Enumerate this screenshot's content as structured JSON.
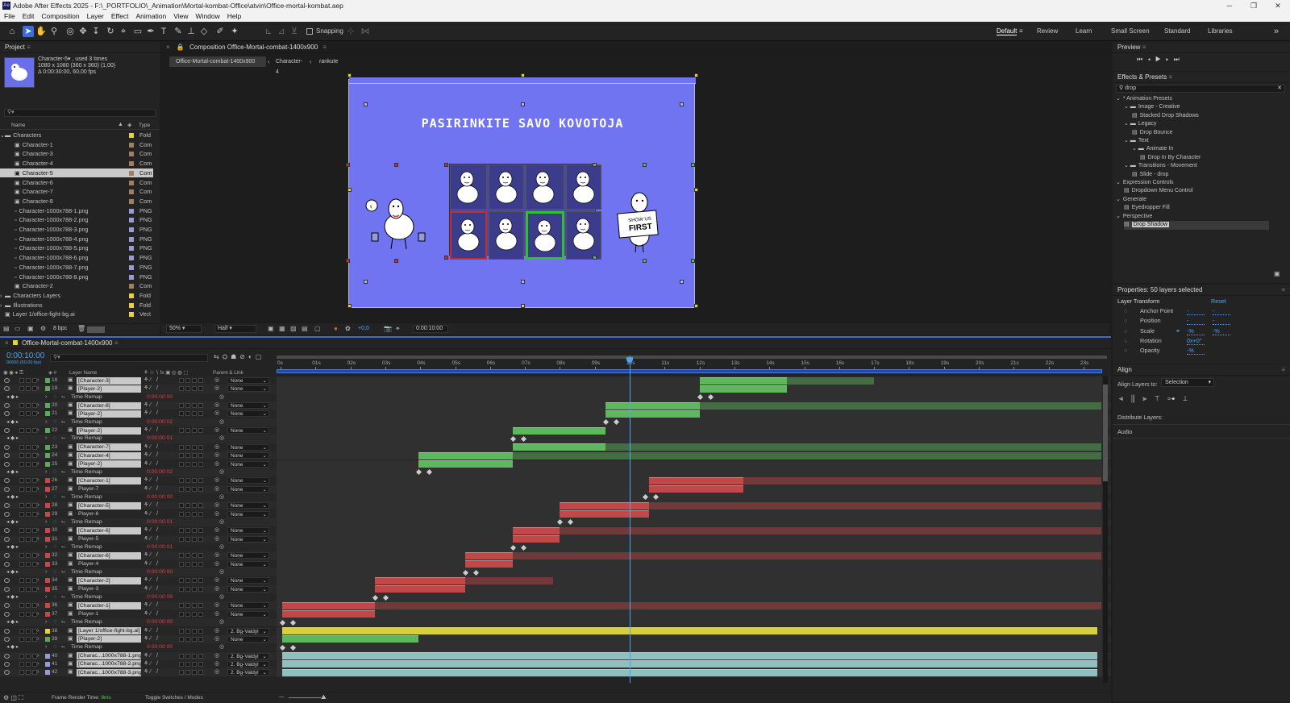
{
  "titlebar": {
    "text": "Adobe After Effects 2025 - F:\\_PORTFOLIO\\_Animation\\Mortal-kombat-Office\\atvin\\Office-mortal-kombat.aep",
    "logo": "Ae"
  },
  "menu": [
    "File",
    "Edit",
    "Composition",
    "Layer",
    "Effect",
    "Animation",
    "View",
    "Window",
    "Help"
  ],
  "toolbar": {
    "snapping": "Snapping",
    "workspaces": [
      "Default",
      "Review",
      "Learn",
      "Small Screen",
      "Standard",
      "Libraries"
    ]
  },
  "project": {
    "title": "Project",
    "selected_name": "Character-5▾ , used 3 times",
    "selected_dims": "1080 x 1080  (360 x 360) (1,00)",
    "selected_dur": "Δ 0:00:30:00, 60,00 fps",
    "col_name": "Name",
    "col_type": "Type",
    "bpc": "8 bpc",
    "items": [
      {
        "name": "Characters",
        "type": "Fold",
        "color": "#e8d23a",
        "indent": 0,
        "folder": true,
        "open": true
      },
      {
        "name": "Character-1",
        "type": "Com",
        "color": "#a08060",
        "indent": 1
      },
      {
        "name": "Character-3",
        "type": "Com",
        "color": "#a08060",
        "indent": 1
      },
      {
        "name": "Character-4",
        "type": "Com",
        "color": "#a08060",
        "indent": 1
      },
      {
        "name": "Character-5",
        "type": "Com",
        "color": "#a08060",
        "indent": 1,
        "selected": true
      },
      {
        "name": "Character-6",
        "type": "Com",
        "color": "#a08060",
        "indent": 1
      },
      {
        "name": "Character-7",
        "type": "Com",
        "color": "#a08060",
        "indent": 1
      },
      {
        "name": "Character-8",
        "type": "Com",
        "color": "#a08060",
        "indent": 1
      },
      {
        "name": "Character-1000x788-1.png",
        "type": "PNG",
        "color": "#9a9ad8",
        "indent": 1
      },
      {
        "name": "Character-1000x788-2.png",
        "type": "PNG",
        "color": "#9a9ad8",
        "indent": 1
      },
      {
        "name": "Character-1000x788-3.png",
        "type": "PNG",
        "color": "#9a9ad8",
        "indent": 1
      },
      {
        "name": "Character-1000x788-4.png",
        "type": "PNG",
        "color": "#9a9ad8",
        "indent": 1
      },
      {
        "name": "Character-1000x788-5.png",
        "type": "PNG",
        "color": "#9a9ad8",
        "indent": 1
      },
      {
        "name": "Character-1000x788-6.png",
        "type": "PNG",
        "color": "#9a9ad8",
        "indent": 1
      },
      {
        "name": "Character-1000x788-7.png",
        "type": "PNG",
        "color": "#9a9ad8",
        "indent": 1
      },
      {
        "name": "Character-1000x788-8.png",
        "type": "PNG",
        "color": "#9a9ad8",
        "indent": 1
      },
      {
        "name": "Character-2",
        "type": "Com",
        "color": "#a08060",
        "indent": 1
      },
      {
        "name": "Characters Layers",
        "type": "Fold",
        "color": "#e8d23a",
        "indent": 0,
        "folder": true
      },
      {
        "name": "Illustrations",
        "type": "Fold",
        "color": "#e8d23a",
        "indent": 0,
        "folder": true
      },
      {
        "name": "Layer 1/office-fight-bg.ai",
        "type": "Vect",
        "color": "#e8d23a",
        "indent": 0
      }
    ]
  },
  "composition": {
    "title": "Composition Office-Mortal-combat-1400x900",
    "crumbs": [
      "Office-Mortal-combat-1400x900",
      "Character-4",
      "rankute"
    ],
    "canvas_title": "PASIRINKITE SAVO KOVOTOJA",
    "sign_text": [
      "SHOW US",
      "FIRST"
    ],
    "zoom": "50%",
    "quality": "Half",
    "exposure": "+0,0",
    "timecode": "0:00:10:00"
  },
  "preview": {
    "title": "Preview"
  },
  "effects": {
    "title": "Effects & Presets",
    "search": "drop",
    "items": [
      {
        "label": "* Animation Presets",
        "level": 0,
        "kind": "arrow"
      },
      {
        "label": "Image - Creative",
        "level": 1,
        "kind": "folder"
      },
      {
        "label": "Stacked Drop Shadows",
        "level": 2,
        "kind": "preset"
      },
      {
        "label": "Legacy",
        "level": 1,
        "kind": "folder"
      },
      {
        "label": "Drop Bounce",
        "level": 2,
        "kind": "preset"
      },
      {
        "label": "Text",
        "level": 1,
        "kind": "folder"
      },
      {
        "label": "Animate In",
        "level": 2,
        "kind": "folder"
      },
      {
        "label": "Drop In By Character",
        "level": 3,
        "kind": "preset"
      },
      {
        "label": "Transitions - Movement",
        "level": 1,
        "kind": "folder"
      },
      {
        "label": "Slide - drop",
        "level": 2,
        "kind": "preset"
      },
      {
        "label": "Expression Controls",
        "level": 0,
        "kind": "arrow"
      },
      {
        "label": "Dropdown Menu Control",
        "level": 1,
        "kind": "preset"
      },
      {
        "label": "Generate",
        "level": 0,
        "kind": "arrow"
      },
      {
        "label": "Eyedropper Fill",
        "level": 1,
        "kind": "preset"
      },
      {
        "label": "Perspective",
        "level": 0,
        "kind": "arrow"
      },
      {
        "label": "Drop Shadow",
        "level": 1,
        "kind": "preset",
        "selected": true
      }
    ]
  },
  "properties": {
    "title": "Properties: 50 layers selected",
    "section": "Layer Transform",
    "reset": "Reset",
    "rows": [
      {
        "label": "Anchor Point",
        "v1": "-",
        "v2": "-"
      },
      {
        "label": "Position",
        "v1": "-",
        "v2": "-"
      },
      {
        "label": "Scale",
        "v1": "-%",
        "v2": "-%"
      },
      {
        "label": "Rotation",
        "v1": "0x+0°",
        "v2": ""
      },
      {
        "label": "Opacity",
        "v1": "-%",
        "v2": ""
      }
    ]
  },
  "align": {
    "title": "Align",
    "align_to_label": "Align Layers to:",
    "align_to": "Selection",
    "distribute": "Distribute Layers:",
    "audio": "Audio"
  },
  "timeline": {
    "tab": "Office-Mortal-combat-1400x900",
    "timecode": "0:00:10:00",
    "sub": "00600 (60.00 fps)",
    "col_layer": "Layer Name",
    "col_parent": "Parent & Link",
    "ruler": [
      "0s",
      "01s",
      "02s",
      "03s",
      "04s",
      "05s",
      "06s",
      "07s",
      "08s",
      "09s",
      "10s",
      "11s",
      "12s",
      "13s",
      "14s",
      "15s",
      "16s",
      "17s",
      "18s",
      "19s",
      "20s",
      "21s",
      "22s",
      "23s"
    ],
    "playhead_sec": 10,
    "footer_render": "Frame Render Time: ",
    "footer_ms": "9ms",
    "footer_toggle": "Toggle Switches / Modes",
    "rows": [
      {
        "t": "layer",
        "num": "18",
        "name": "[Character-3]",
        "color": "#5aaa5a",
        "parent": "None",
        "start": 12,
        "end": 14.5,
        "bar": "#5db85d",
        "ext": 17
      },
      {
        "t": "layer",
        "num": "19",
        "name": "[Player-2]",
        "color": "#5aaa5a",
        "parent": "None",
        "start": 12,
        "end": 14.5,
        "bar": "#5db85d"
      },
      {
        "t": "remap",
        "label": "Time Remap",
        "val": "0:00:00:00",
        "keys": [
          12,
          12.3
        ]
      },
      {
        "t": "layer",
        "num": "20",
        "name": "[Character-8]",
        "color": "#5aaa5a",
        "parent": "None",
        "start": 9.3,
        "end": 12,
        "bar": "#5db85d",
        "ext": 23.5
      },
      {
        "t": "layer",
        "num": "21",
        "name": "[Player-2]",
        "color": "#5aaa5a",
        "parent": "None",
        "start": 9.3,
        "end": 12,
        "bar": "#5db85d"
      },
      {
        "t": "remap",
        "label": "Time Remap",
        "val": "0:00:00:02",
        "keys": [
          9.3,
          9.6
        ]
      },
      {
        "t": "layer",
        "num": "22",
        "name": "[Player-2]",
        "color": "#5aaa5a",
        "parent": "None",
        "start": 6.65,
        "end": 9.3,
        "bar": "#5db85d"
      },
      {
        "t": "remap",
        "label": "Time Remap",
        "val": "0:00:00:01",
        "keys": [
          6.65,
          6.95
        ]
      },
      {
        "t": "layer",
        "num": "23",
        "name": "[Character-7]",
        "color": "#5aaa5a",
        "parent": "None",
        "start": 6.65,
        "end": 9.3,
        "bar": "#5db85d",
        "ext": 23.5
      },
      {
        "t": "layer",
        "num": "24",
        "name": "[Character-4]",
        "color": "#5aaa5a",
        "parent": "None",
        "start": 3.95,
        "end": 6.65,
        "bar": "#5db85d",
        "ext": 23.5
      },
      {
        "t": "layer",
        "num": "25",
        "name": "[Player-2]",
        "color": "#5aaa5a",
        "parent": "None",
        "start": 3.95,
        "end": 6.65,
        "bar": "#5db85d"
      },
      {
        "t": "remap",
        "label": "Time Remap",
        "val": "0:00:00:02",
        "keys": [
          3.95,
          4.25
        ]
      },
      {
        "t": "layer",
        "num": "26",
        "name": "[Character-1]",
        "color": "#c84848",
        "parent": "None",
        "start": 10.55,
        "end": 13.25,
        "bar": "#c04848",
        "ext": 23.5
      },
      {
        "t": "layer",
        "num": "27",
        "name": "Player-7",
        "color": "#c84848",
        "parent": "None",
        "start": 10.55,
        "end": 13.25,
        "bar": "#c04848"
      },
      {
        "t": "remap",
        "label": "Time Remap",
        "val": "0:00:00:00",
        "keys": [
          10.45,
          10.75
        ]
      },
      {
        "t": "layer",
        "num": "28",
        "name": "[Character-5]",
        "color": "#c84848",
        "parent": "None",
        "start": 8,
        "end": 10.55,
        "bar": "#c04848",
        "ext": 23.5
      },
      {
        "t": "layer",
        "num": "29",
        "name": "Player-6",
        "color": "#c84848",
        "parent": "None",
        "start": 8,
        "end": 10.55,
        "bar": "#c04848"
      },
      {
        "t": "remap",
        "label": "Time Remap",
        "val": "0:00:00:01",
        "keys": [
          8,
          8.3
        ]
      },
      {
        "t": "layer",
        "num": "30",
        "name": "[Character-6]",
        "color": "#c84848",
        "parent": "None",
        "start": 6.65,
        "end": 8,
        "bar": "#c04848",
        "ext": 23.5
      },
      {
        "t": "layer",
        "num": "31",
        "name": "Player-5",
        "color": "#c84848",
        "parent": "None",
        "start": 6.65,
        "end": 8,
        "bar": "#c04848"
      },
      {
        "t": "remap",
        "label": "Time Remap",
        "val": "0:00:00:01",
        "keys": [
          6.65,
          6.95
        ]
      },
      {
        "t": "layer",
        "num": "32",
        "name": "[Character-6]",
        "color": "#c84848",
        "parent": "None",
        "start": 5.3,
        "end": 6.65,
        "bar": "#c04848",
        "ext": 23.5
      },
      {
        "t": "layer",
        "num": "33",
        "name": "Player-4",
        "color": "#c84848",
        "parent": "None",
        "start": 5.3,
        "end": 6.65,
        "bar": "#c04848"
      },
      {
        "t": "remap",
        "label": "Time Remap",
        "val": "0:00:00:00",
        "keys": [
          5.3,
          5.6
        ]
      },
      {
        "t": "layer",
        "num": "34",
        "name": "[Character-2]",
        "color": "#c84848",
        "parent": "None",
        "start": 2.7,
        "end": 5.3,
        "bar": "#c04848",
        "ext": 7.8
      },
      {
        "t": "layer",
        "num": "35",
        "name": "Player-3",
        "color": "#c84848",
        "parent": "None",
        "start": 2.7,
        "end": 5.3,
        "bar": "#c04848"
      },
      {
        "t": "remap",
        "label": "Time Remap",
        "val": "0:00:00:09",
        "keys": [
          2.7,
          3
        ]
      },
      {
        "t": "layer",
        "num": "36",
        "name": "[Character-1]",
        "color": "#c84848",
        "parent": "None",
        "start": 0.05,
        "end": 2.7,
        "bar": "#c04848",
        "ext": 23.5
      },
      {
        "t": "layer",
        "num": "37",
        "name": "Player-1",
        "color": "#c84848",
        "parent": "None",
        "start": 0.05,
        "end": 2.7,
        "bar": "#c04848"
      },
      {
        "t": "remap",
        "label": "Time Remap",
        "val": "0:00:00:00",
        "keys": [
          0.05,
          0.35
        ]
      },
      {
        "t": "layer",
        "num": "38",
        "name": "[Layer 1/office-fight-bg.ai]",
        "color": "#e8d23a",
        "parent": "2. Bg-Valdyl",
        "start": 0.05,
        "end": 23.4,
        "bar": "#d8d038"
      },
      {
        "t": "layer",
        "num": "39",
        "name": "[Player-2]",
        "color": "#5aaa5a",
        "parent": "None",
        "start": 0.05,
        "end": 3.95,
        "bar": "#5db85d"
      },
      {
        "t": "remap",
        "label": "Time Remap",
        "val": "0:00:00:00",
        "keys": [
          0.05,
          0.35
        ]
      },
      {
        "t": "layer",
        "num": "40",
        "name": "[Charac...1000x788-1.png]",
        "color": "#9a9ad8",
        "parent": "2. Bg-Valdyl",
        "start": 0.05,
        "end": 23.4,
        "bar": "#8fbfbf"
      },
      {
        "t": "layer",
        "num": "41",
        "name": "[Charac...1000x788-2.png]",
        "color": "#9a9ad8",
        "parent": "2. Bg-Valdyl",
        "start": 0.05,
        "end": 23.4,
        "bar": "#8fbfbf"
      },
      {
        "t": "layer",
        "num": "42",
        "name": "[Charac...1000x788-3.png]",
        "color": "#9a9ad8",
        "parent": "2. Bg-Valdyl",
        "start": 0.05,
        "end": 23.4,
        "bar": "#8fbfbf"
      }
    ]
  }
}
